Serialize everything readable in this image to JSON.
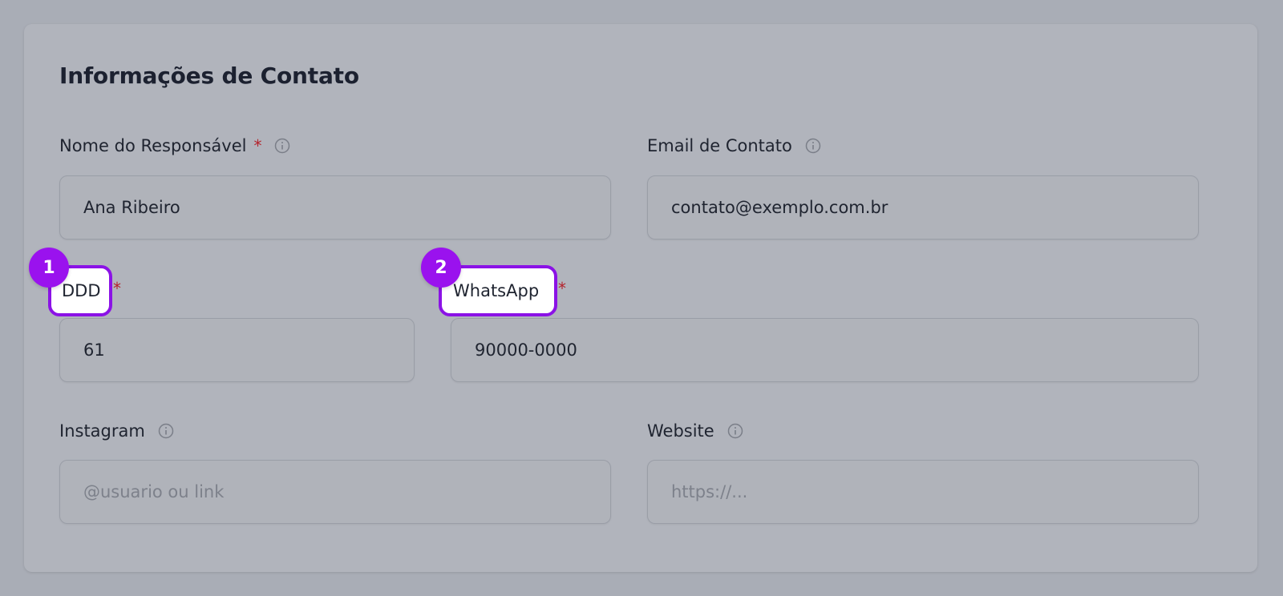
{
  "section": {
    "title": "Informações de Contato"
  },
  "fields": {
    "responsavel": {
      "label": "Nome do Responsável",
      "required_mark": "*",
      "value": "Ana Ribeiro"
    },
    "email": {
      "label": "Email de Contato",
      "value": "contato@exemplo.com.br"
    },
    "ddd": {
      "label": "DDD",
      "required_mark": "*",
      "value": "61"
    },
    "whatsapp": {
      "label": "WhatsApp",
      "required_mark": "*",
      "value": "90000-0000"
    },
    "instagram": {
      "label": "Instagram",
      "placeholder": "@usuario ou link"
    },
    "website": {
      "label": "Website",
      "placeholder": "https://..."
    }
  },
  "annotations": [
    {
      "number": "1",
      "target": "DDD"
    },
    {
      "number": "2",
      "target": "WhatsApp"
    }
  ],
  "colors": {
    "page_background": "#a9adb6",
    "card_background": "#b1b4bc",
    "required": "#b4232c",
    "highlight_border": "#8b12e6",
    "badge": "#9a12ee"
  },
  "icons": {
    "info": "info-circle-icon"
  }
}
